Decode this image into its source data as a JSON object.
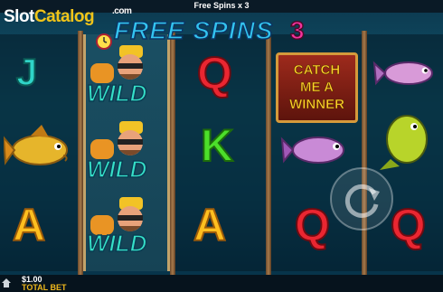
{
  "top_bar": {
    "free_spins_text": "Free Spins x 3"
  },
  "watermark": {
    "part1": "Slot",
    "part2": "Catalog",
    "part3": ".com"
  },
  "header": {
    "banner": "FREE SPINS",
    "count": "3"
  },
  "reels": {
    "col1": [
      "J",
      "fish",
      "A"
    ],
    "col2": [
      "WILD",
      "WILD",
      "WILD"
    ],
    "col3": [
      "Q",
      "K",
      "A"
    ],
    "col4": [
      "CATCH ME A WINNER",
      "fish",
      "Q"
    ],
    "col5": [
      "fish",
      "fish",
      "Q"
    ]
  },
  "wild_label": "WILD",
  "catch_box": {
    "line1": "CATCH",
    "line2": "ME A",
    "line3": "WINNER"
  },
  "bottom_bar": {
    "bet_value": "$1.00",
    "bet_label": "TOTAL BET"
  },
  "colors": {
    "accent_blue": "#33c4f0",
    "accent_pink": "#f5339e",
    "gold": "#f0b81c"
  },
  "icons": {
    "autoplay": "circular-arrow-icon",
    "home": "home-icon",
    "bonus_clock": "clock-icon"
  }
}
